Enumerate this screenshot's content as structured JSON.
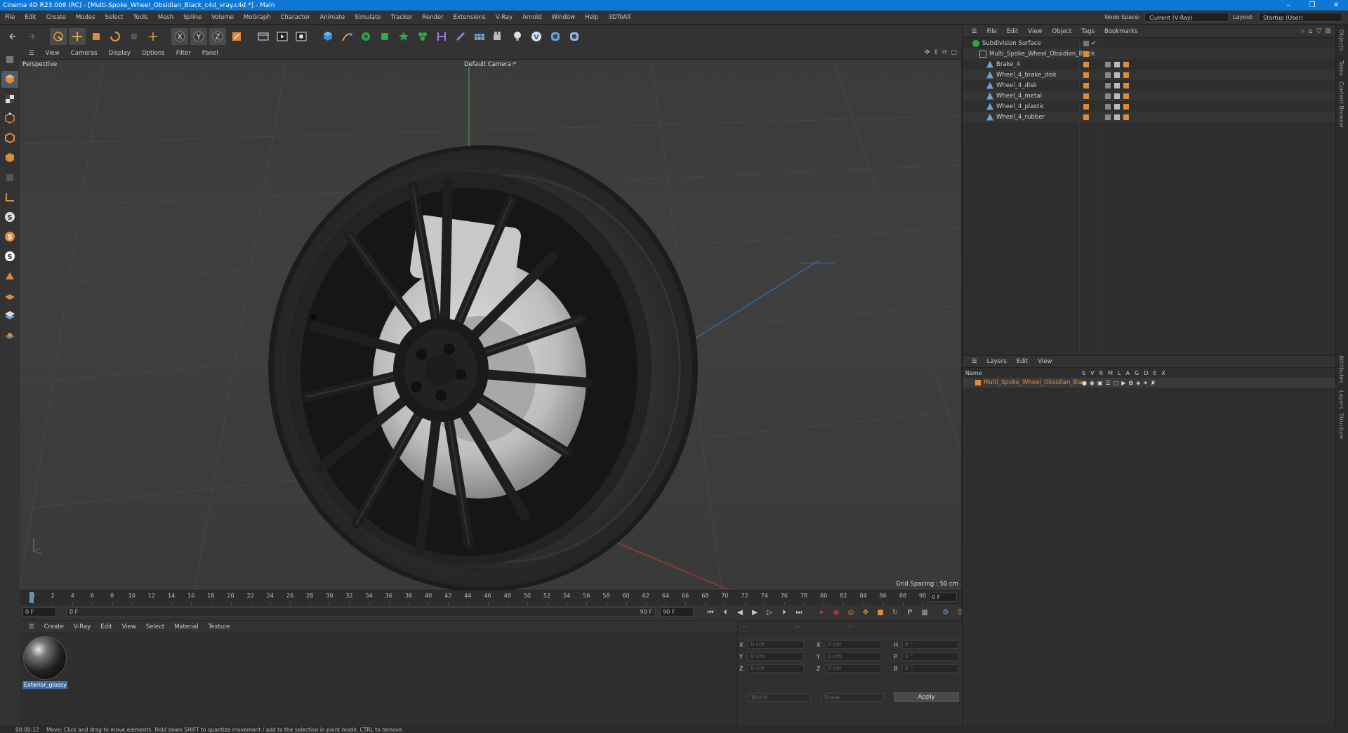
{
  "window": {
    "title": "Cinema 4D R23.008 (RC) - [Multi-Spoke_Wheel_Obsidian_Black_c4d_vray.c4d *] - Main",
    "controls": [
      "–",
      "❐",
      "✕"
    ]
  },
  "menubar": {
    "items": [
      "File",
      "Edit",
      "Create",
      "Modes",
      "Select",
      "Tools",
      "Mesh",
      "Spline",
      "Volume",
      "MoGraph",
      "Character",
      "Animate",
      "Simulate",
      "Tracker",
      "Render",
      "Extensions",
      "V-Ray",
      "Arnold",
      "Window",
      "Help",
      "3DToAll"
    ],
    "node_space_label": "Node Space:",
    "node_space_value": "Current (V-Ray)",
    "layout_label": "Layout:",
    "layout_value": "Startup (User)"
  },
  "viewport": {
    "menu": [
      "View",
      "Cameras",
      "Display",
      "Options",
      "Filter",
      "Panel"
    ],
    "projection": "Perspective",
    "camera": "Default Camera:*",
    "grid_spacing": "Grid Spacing : 50 cm"
  },
  "timeline": {
    "ticks": [
      "0",
      "2",
      "4",
      "6",
      "8",
      "10",
      "12",
      "14",
      "16",
      "18",
      "20",
      "22",
      "24",
      "26",
      "28",
      "30",
      "32",
      "34",
      "36",
      "38",
      "40",
      "42",
      "44",
      "46",
      "48",
      "50",
      "52",
      "54",
      "56",
      "58",
      "60",
      "62",
      "64",
      "66",
      "68",
      "70",
      "72",
      "74",
      "76",
      "78",
      "80",
      "82",
      "84",
      "86",
      "88",
      "90"
    ],
    "current_frame": "0 F",
    "start_field": "0 F",
    "min_field": "0 F",
    "max_field": "90 F",
    "end_field": "90 F"
  },
  "material_manager": {
    "menu": [
      "Create",
      "V-Ray",
      "Edit",
      "View",
      "Select",
      "Material",
      "Texture"
    ],
    "materials": [
      {
        "name": "Exterior_glossy"
      }
    ]
  },
  "coordinates": {
    "header": [
      "--",
      "--",
      "--"
    ],
    "rows": [
      {
        "a_label": "X",
        "a_val": "0 cm",
        "b_label": "X",
        "b_val": "0 cm",
        "c_label": "H",
        "c_val": "0 °"
      },
      {
        "a_label": "Y",
        "a_val": "0 cm",
        "b_label": "Y",
        "b_val": "0 cm",
        "c_label": "P",
        "c_val": "0 °"
      },
      {
        "a_label": "Z",
        "a_val": "0 cm",
        "b_label": "Z",
        "b_val": "0 cm",
        "c_label": "B",
        "c_val": "0 °"
      }
    ],
    "space_dropdown": "World",
    "mode_dropdown": "Scale",
    "apply_label": "Apply"
  },
  "object_manager": {
    "menu": [
      "File",
      "Edit",
      "View",
      "Object",
      "Tags",
      "Bookmarks"
    ],
    "objects": [
      {
        "name": "Subdivision Surface",
        "indent": 0
      },
      {
        "name": "Multi_Spoke_Wheel_Obsidian_Black",
        "indent": 1
      },
      {
        "name": "Brake_4",
        "indent": 2
      },
      {
        "name": "Wheel_4_brake_disk",
        "indent": 2
      },
      {
        "name": "Wheel_4_disk",
        "indent": 2
      },
      {
        "name": "Wheel_4_metal",
        "indent": 2
      },
      {
        "name": "Wheel_4_plastic",
        "indent": 2
      },
      {
        "name": "Wheel_4_rubber",
        "indent": 2
      }
    ]
  },
  "layers": {
    "menu": [
      "Layers",
      "Edit",
      "View"
    ],
    "col_name": "Name",
    "col_flags": [
      "S",
      "V",
      "R",
      "M",
      "L",
      "A",
      "G",
      "D",
      "E",
      "X"
    ],
    "rows": [
      {
        "name": "Multi_Spoke_Wheel_Obsidian_Black"
      }
    ]
  },
  "side_tabs": [
    "Objects",
    "Takes",
    "Content Browser",
    "Attributes",
    "Layers",
    "Structure"
  ],
  "status": {
    "time": "00:00:12",
    "message": "Move: Click and drag to move elements. Hold down SHIFT to quantize movement / add to the selection in point mode, CTRL to remove."
  },
  "colors": {
    "title_bar": "#0f78d7",
    "accent_orange": "#e08a3c",
    "selection_blue": "#3f6ea5"
  }
}
